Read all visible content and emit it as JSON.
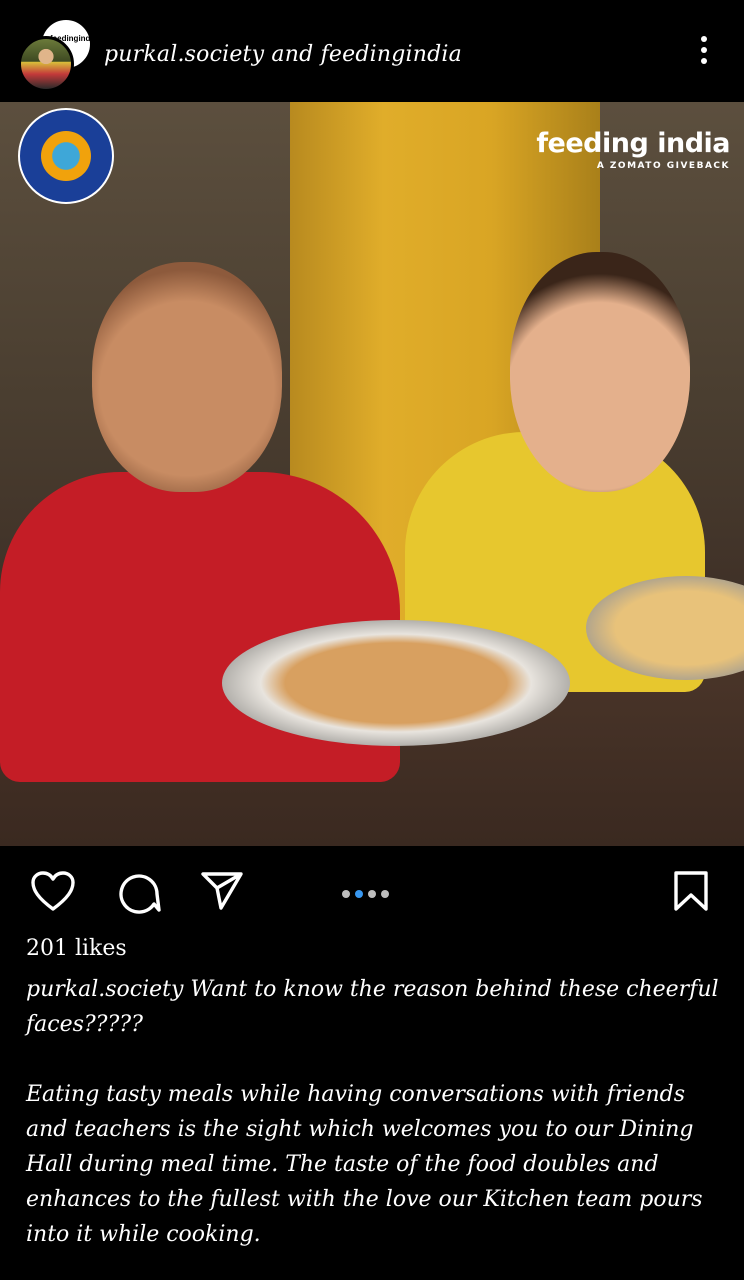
{
  "header": {
    "account_text": "purkal.society and feedingindia",
    "avatar_back_text": "feedingindia"
  },
  "photo": {
    "brand_name": "feeding india",
    "brand_tagline": "A ZOMATO GIVEBACK"
  },
  "actions": {
    "carousel_total": 4,
    "carousel_active": 2
  },
  "post": {
    "likes": "201 likes",
    "caption_line1": "purkal.society Want to know the reason behind these cheerful faces?????",
    "caption_para2": "Eating tasty meals while having conversations with friends and teachers is the sight which welcomes you to our Dining Hall during meal time. The taste of the food doubles and enhances to the fullest with the love our Kitchen team pours into it while cooking."
  },
  "colors": {
    "background": "#000000",
    "active_dot": "#3897f0",
    "inactive_dot": "#bdbdbd"
  }
}
